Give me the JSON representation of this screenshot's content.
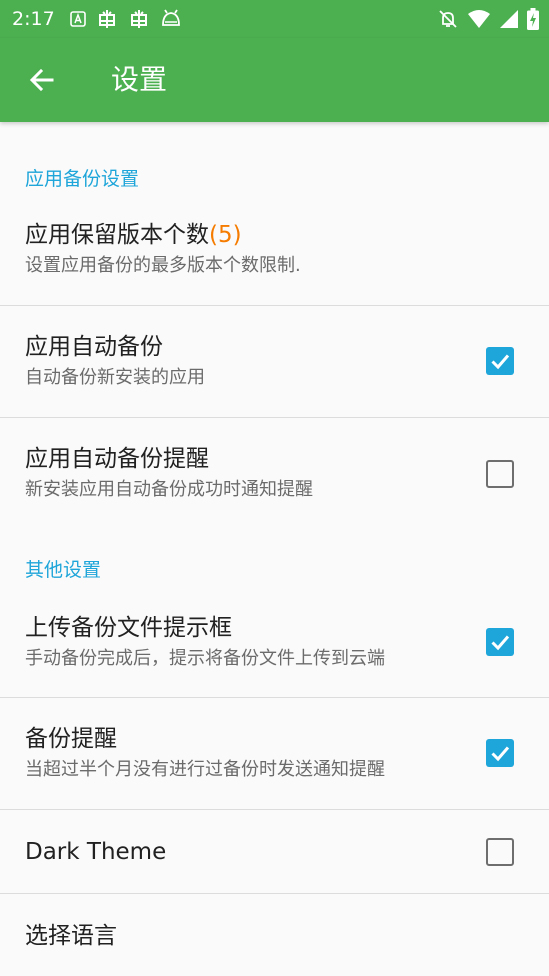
{
  "status_bar": {
    "time": "2:17"
  },
  "app_bar": {
    "title": "设置"
  },
  "sections": {
    "app_backup": {
      "header": "应用备份设置"
    },
    "other": {
      "header": "其他设置"
    }
  },
  "prefs": {
    "keep_versions": {
      "title": "应用保留版本个数",
      "count": "(5)",
      "summary": "设置应用备份的最多版本个数限制."
    },
    "auto_backup": {
      "title": "应用自动备份",
      "summary": "自动备份新安装的应用",
      "checked": true
    },
    "auto_backup_reminder": {
      "title": "应用自动备份提醒",
      "summary": "新安装应用自动备份成功时通知提醒",
      "checked": false
    },
    "upload_prompt": {
      "title": "上传备份文件提示框",
      "summary": "手动备份完成后，提示将备份文件上传到云端",
      "checked": true
    },
    "backup_reminder": {
      "title": "备份提醒",
      "summary": "当超过半个月没有进行过备份时发送通知提醒",
      "checked": true
    },
    "dark_theme": {
      "title": "Dark Theme",
      "checked": false
    },
    "language": {
      "title": "选择语言"
    }
  },
  "colors": {
    "primary": "#4caf50",
    "accent": "#1ea5d9",
    "count_highlight": "#f57c00"
  },
  "icons": {
    "back": "arrow-left-icon",
    "check": "check-icon"
  }
}
